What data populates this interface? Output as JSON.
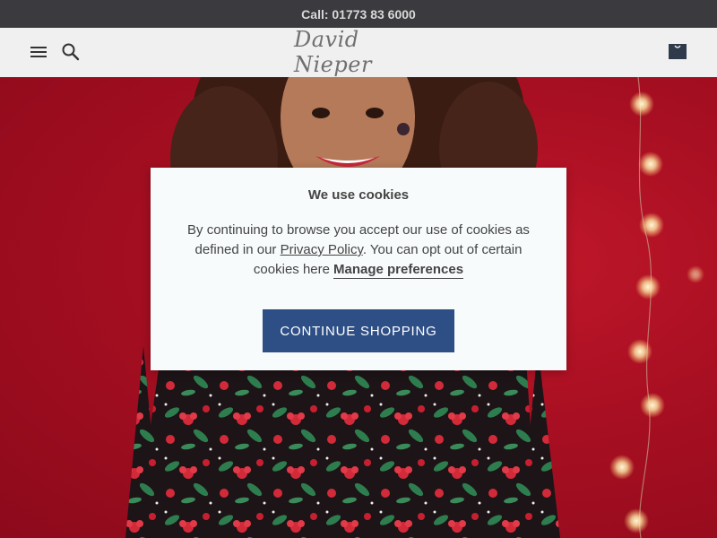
{
  "topbar": {
    "phone_text": "Call: 01773 83 6000"
  },
  "header": {
    "logo_text": "David Nieper",
    "menu_icon": "hamburger-menu-icon",
    "search_icon": "search-icon",
    "bag_icon": "shopping-bag-icon"
  },
  "hero": {
    "background_color": "#a90f22",
    "accent_color": "#2e4f86"
  },
  "cookie_modal": {
    "title": "We use cookies",
    "body_prefix": "By continuing to browse you accept our use of cookies as defined in our ",
    "privacy_link": "Privacy Policy",
    "body_middle": ". You can opt out of certain cookies here",
    "manage_link": "Manage preferences",
    "continue_button": "CONTINUE SHOPPING"
  }
}
